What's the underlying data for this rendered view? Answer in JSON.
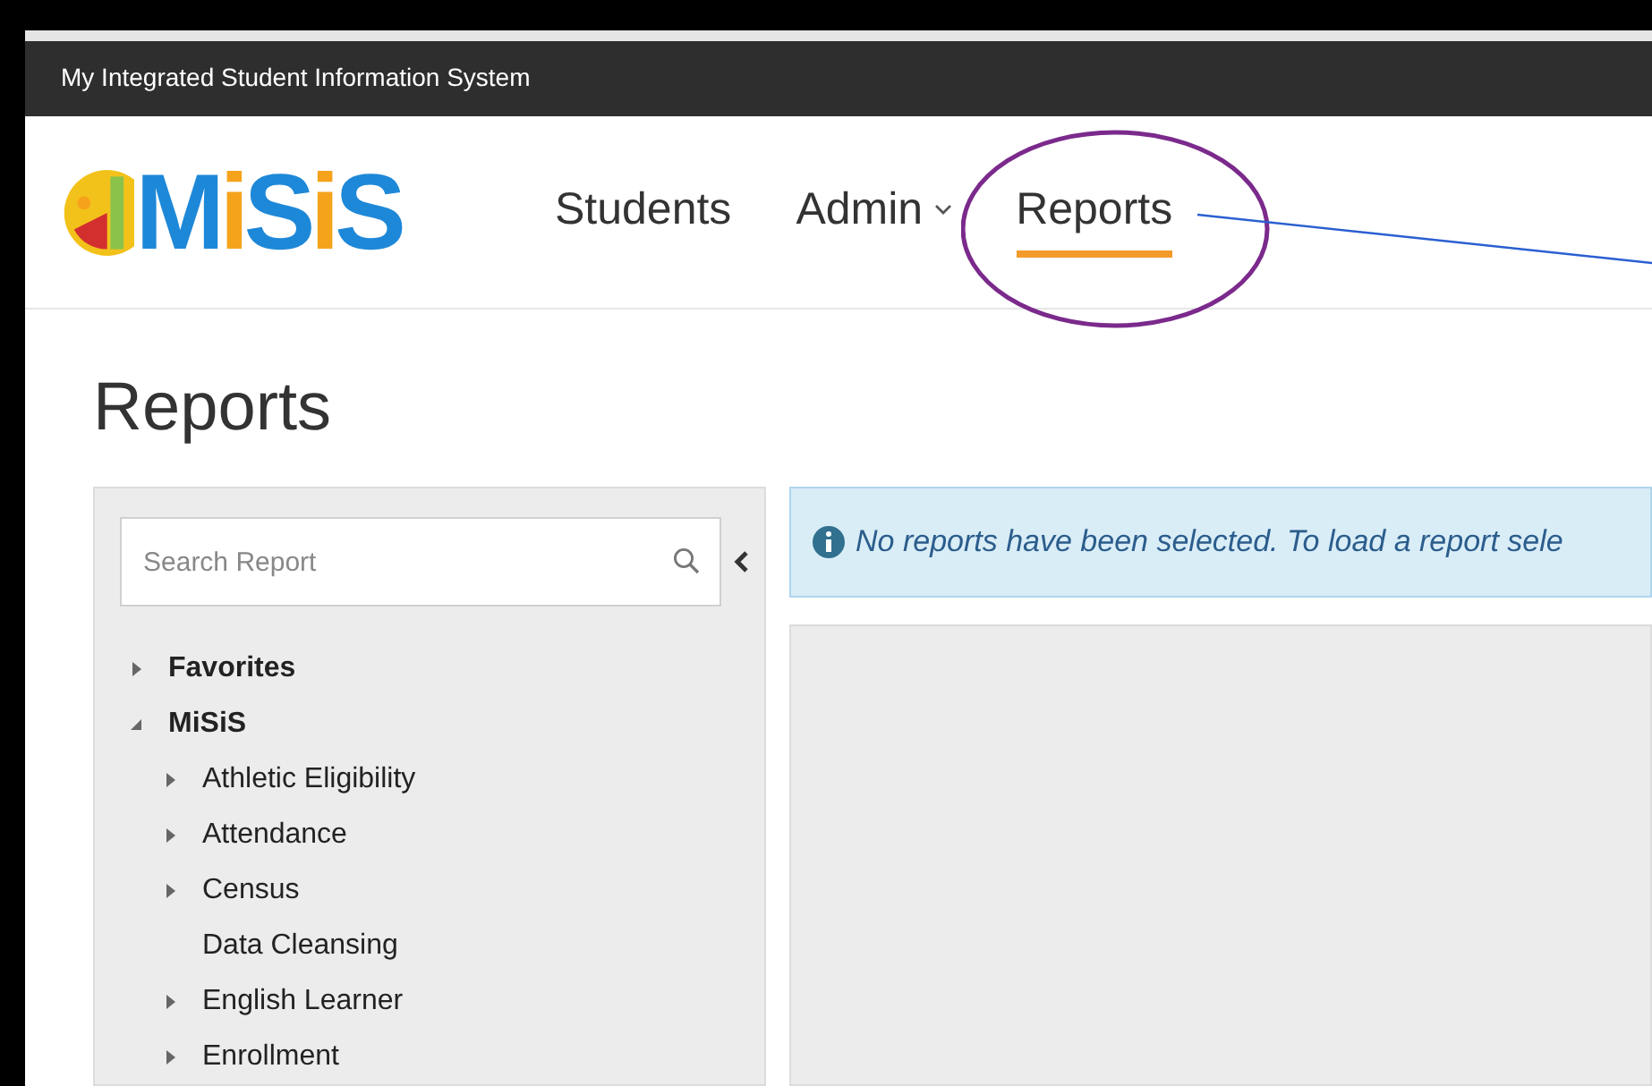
{
  "top_bar": {
    "title": "My Integrated Student Information System"
  },
  "logo": {
    "text": "MiSiS"
  },
  "nav": [
    {
      "label": "Students",
      "selected": false,
      "dropdown": false
    },
    {
      "label": "Admin",
      "selected": false,
      "dropdown": true
    },
    {
      "label": "Reports",
      "selected": true,
      "dropdown": false
    }
  ],
  "page_title": "Reports",
  "search": {
    "placeholder": "Search Report"
  },
  "tree": [
    {
      "label": "Favorites",
      "kind": "folder",
      "expanded": false
    },
    {
      "label": "MiSiS",
      "kind": "folder",
      "expanded": true,
      "children": [
        {
          "label": "Athletic Eligibility",
          "kind": "folder",
          "expanded": false
        },
        {
          "label": "Attendance",
          "kind": "folder",
          "expanded": false
        },
        {
          "label": "Census",
          "kind": "folder",
          "expanded": false
        },
        {
          "label": "Data Cleansing",
          "kind": "report"
        },
        {
          "label": "English Learner",
          "kind": "folder",
          "expanded": false
        },
        {
          "label": "Enrollment",
          "kind": "folder",
          "expanded": false
        }
      ]
    }
  ],
  "alert": {
    "text": "No reports have been selected. To load a report sele"
  }
}
